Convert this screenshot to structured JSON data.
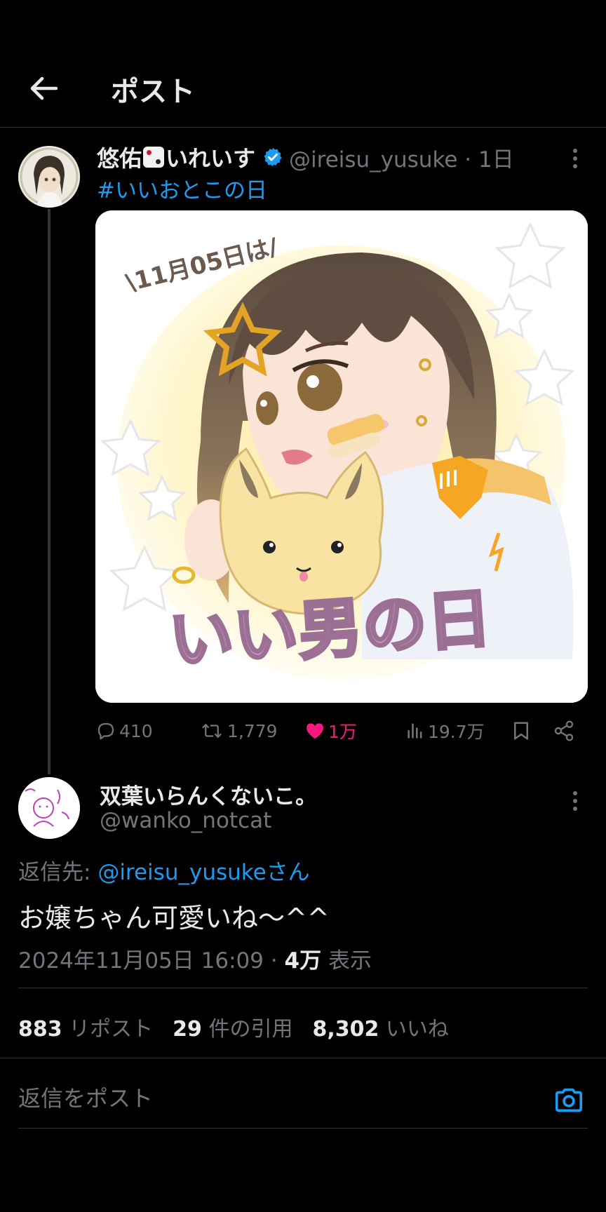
{
  "header": {
    "title": "ポスト"
  },
  "tweet": {
    "display_name": "悠佑",
    "display_name_suffix": "いれいす",
    "emoji": "dice",
    "handle_time": "@ireisu_yusuke · 1日",
    "hashtag": "#いいおとこの日",
    "image_text_top": "\\11月05日は/",
    "image_text_bottom": "いい男の日",
    "actions": {
      "replies": "410",
      "reposts": "1,779",
      "likes": "1万",
      "views": "19.7万"
    },
    "colors": {
      "link": "#1d9bf0",
      "like": "#f91880",
      "verified": "#1d9bf0"
    }
  },
  "reply": {
    "display_name": "双葉いらんくないこ。",
    "handle": "@wanko_notcat",
    "reply_to_prefix": "返信先: ",
    "reply_to_mention": "@ireisu_yusukeさん",
    "body": "お嬢ちゃん可愛いね〜^^",
    "timestamp": "2024年11月05日 16:09 · ",
    "views_count": "4万",
    "views_label": " 表示"
  },
  "stats": {
    "reposts_count": "883",
    "reposts_label": "リポスト",
    "quotes_count": "29",
    "quotes_label": "件の引用",
    "likes_count": "8,302",
    "likes_label": "いいね"
  },
  "composer": {
    "placeholder": "返信をポスト"
  }
}
